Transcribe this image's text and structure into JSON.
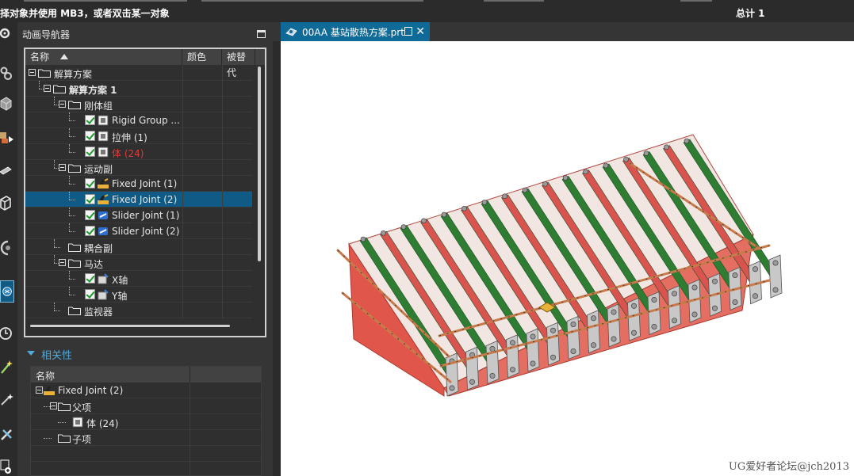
{
  "status": {
    "prompt": "择对象并使用 MB3，或者双击某一对象",
    "total": "总计 1"
  },
  "toolbar_icons": [
    "gear-icon",
    "gears-icon",
    "cube-icon",
    "motion-icon",
    "plate-icon",
    "box-icon",
    "spring-icon",
    "animation-icon",
    "clock-icon",
    "wizard-icon",
    "spark-icon",
    "tools-icon",
    "add-icon"
  ],
  "navigator": {
    "title": "动画导航器",
    "columns": [
      "名称",
      "颜色",
      "被替代"
    ],
    "rows": [
      {
        "label": "解算方案",
        "icon": "folder-icon",
        "expander": true,
        "checked": false,
        "selected": false
      },
      {
        "label": "解算方案 1",
        "icon": "folder-icon",
        "expander": true,
        "checked": false,
        "bold": true,
        "selected": false
      },
      {
        "label": "刚体组",
        "icon": "folder-icon",
        "expander": true,
        "checked": false,
        "selected": false
      },
      {
        "label": "Rigid Group ...",
        "icon": "body-icon",
        "checked": true,
        "selected": false
      },
      {
        "label": "拉伸 (1)",
        "icon": "body-icon",
        "checked": true,
        "selected": false
      },
      {
        "label": "体 (24)",
        "icon": "body-icon",
        "checked": true,
        "red": true,
        "selected": false
      },
      {
        "label": "运动副",
        "icon": "folder-icon",
        "expander": true,
        "checked": false,
        "selected": false
      },
      {
        "label": "Fixed Joint (1)",
        "icon": "fixed-joint-icon",
        "checked": true,
        "selected": false
      },
      {
        "label": "Fixed Joint (2)",
        "icon": "fixed-joint-icon",
        "checked": true,
        "selected": true
      },
      {
        "label": "Slider Joint (1)",
        "icon": "slider-joint-icon",
        "checked": true,
        "selected": false
      },
      {
        "label": "Slider Joint (2)",
        "icon": "slider-joint-icon",
        "checked": true,
        "selected": false
      },
      {
        "label": "耦合副",
        "icon": "folder-icon",
        "checked": false,
        "selected": false
      },
      {
        "label": "马达",
        "icon": "folder-icon",
        "expander": true,
        "checked": false,
        "selected": false
      },
      {
        "label": "X轴",
        "icon": "motor-icon",
        "checked": true,
        "selected": false
      },
      {
        "label": "Y轴",
        "icon": "motor-icon",
        "checked": true,
        "selected": false
      },
      {
        "label": "监视器",
        "icon": "folder-icon",
        "checked": false,
        "selected": false
      }
    ]
  },
  "relations": {
    "title": "相关性",
    "columns": [
      "名称"
    ],
    "rows": [
      {
        "label": "Fixed Joint (2)",
        "icon": "fixed-joint-icon"
      },
      {
        "label": "父项",
        "icon": "folder-icon"
      },
      {
        "label": "体 (24)",
        "icon": "body-icon"
      },
      {
        "label": "子项",
        "icon": "folder-icon"
      }
    ]
  },
  "document_tab": {
    "title": "00AA 基站散热方案.prt"
  },
  "watermark": "UG爱好者论坛@jch2013",
  "colors": {
    "panel_bg": "#353535",
    "selection": "#0f5b86",
    "tab_active": "#0f6a97",
    "accent_text": "#4fa9da",
    "error_text": "#e23a3a",
    "model_base": "#e0564a",
    "model_fin_green": "#2e7d32",
    "model_fin_red": "#d9534f",
    "model_plate": "#c8c8c8"
  }
}
